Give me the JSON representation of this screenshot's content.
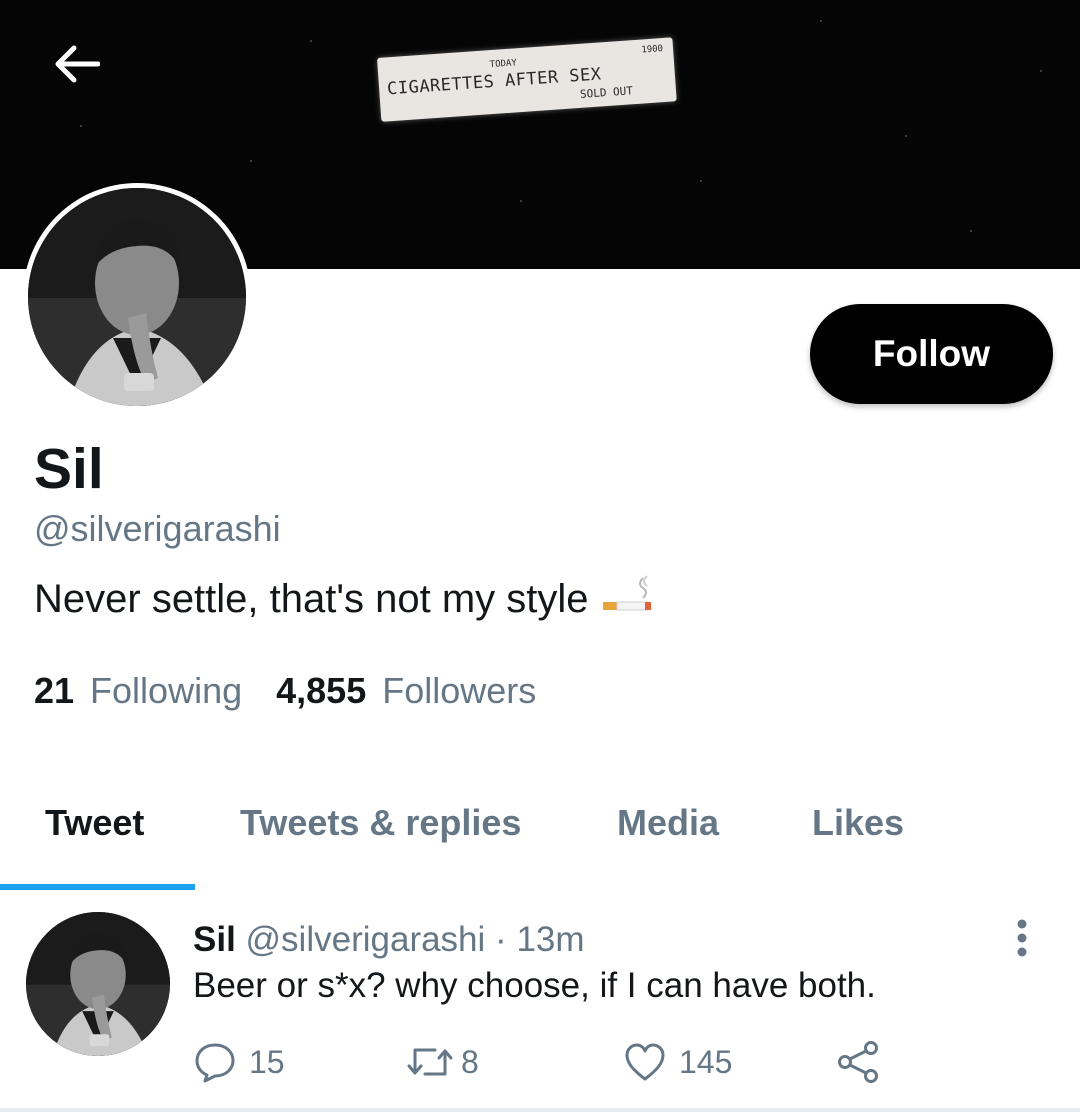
{
  "banner": {
    "marquee": {
      "line1": "CIGARETTES AFTER SEX",
      "small": "TODAY",
      "year": "1900",
      "line2": "SOLD OUT"
    }
  },
  "profile": {
    "name": "Sil",
    "handle": "@silverigarashi",
    "bio": "Never settle, that's not my style",
    "bio_emoji": "cigarette-icon",
    "follow_label": "Follow",
    "following_count": "21",
    "following_label": "Following",
    "followers_count": "4,855",
    "followers_label": "Followers"
  },
  "tabs": [
    {
      "label": "Tweet",
      "active": true
    },
    {
      "label": "Tweets & replies",
      "active": false
    },
    {
      "label": "Media",
      "active": false
    },
    {
      "label": "Likes",
      "active": false
    }
  ],
  "tweet": {
    "name": "Sil",
    "handle": "@silverigarashi",
    "separator": "·",
    "time": "13m",
    "text": "Beer or s*x? why choose, if I can have both.",
    "replies": "15",
    "retweets": "8",
    "likes": "145"
  },
  "colors": {
    "accent": "#1da1f2",
    "text_primary": "#14171a",
    "text_secondary": "#657786",
    "button_bg": "#000000"
  }
}
